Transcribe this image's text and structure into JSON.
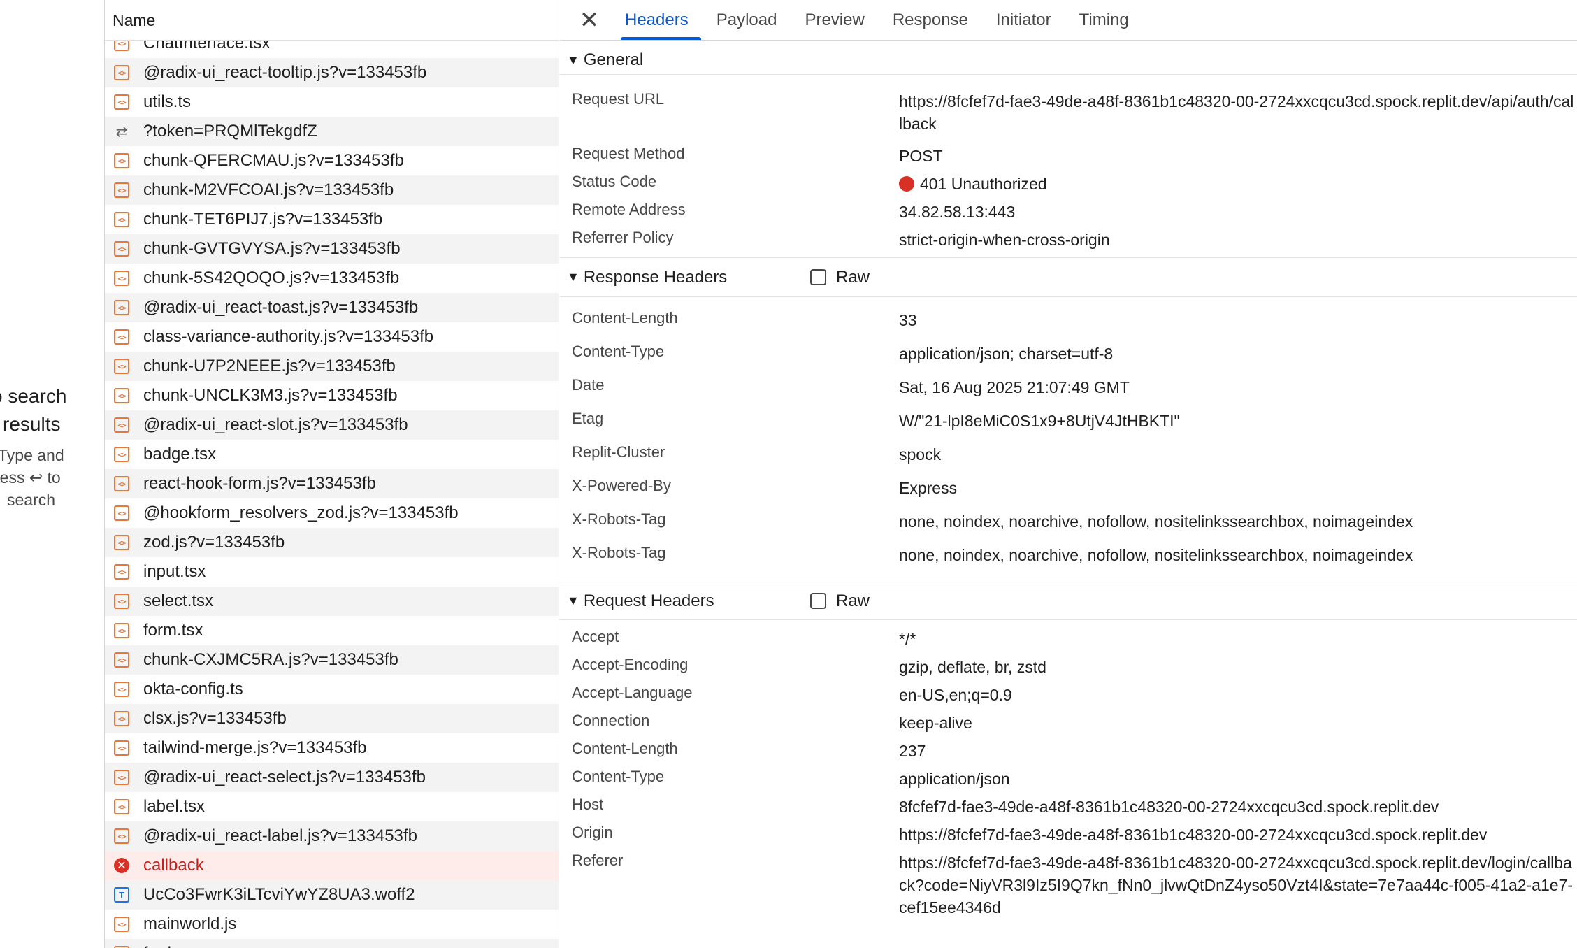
{
  "search_panel": {
    "no_results_line1": "o search",
    "no_results_line2": "results",
    "hint_line1": "Type and",
    "hint_line2": "ress ↩ to",
    "hint_line3": "search"
  },
  "request_list": {
    "header": "Name",
    "rows": [
      {
        "name": "ChatInterface.tsx",
        "icon": "script"
      },
      {
        "name": "@radix-ui_react-tooltip.js?v=133453fb",
        "icon": "script"
      },
      {
        "name": "utils.ts",
        "icon": "script"
      },
      {
        "name": "?token=PRQMlTekgdfZ",
        "icon": "redirect"
      },
      {
        "name": "chunk-QFERCMAU.js?v=133453fb",
        "icon": "script"
      },
      {
        "name": "chunk-M2VFCOAI.js?v=133453fb",
        "icon": "script"
      },
      {
        "name": "chunk-TET6PIJ7.js?v=133453fb",
        "icon": "script"
      },
      {
        "name": "chunk-GVTGVYSA.js?v=133453fb",
        "icon": "script"
      },
      {
        "name": "chunk-5S42QOQO.js?v=133453fb",
        "icon": "script"
      },
      {
        "name": "@radix-ui_react-toast.js?v=133453fb",
        "icon": "script"
      },
      {
        "name": "class-variance-authority.js?v=133453fb",
        "icon": "script"
      },
      {
        "name": "chunk-U7P2NEEE.js?v=133453fb",
        "icon": "script"
      },
      {
        "name": "chunk-UNCLK3M3.js?v=133453fb",
        "icon": "script"
      },
      {
        "name": "@radix-ui_react-slot.js?v=133453fb",
        "icon": "script"
      },
      {
        "name": "badge.tsx",
        "icon": "script"
      },
      {
        "name": "react-hook-form.js?v=133453fb",
        "icon": "script"
      },
      {
        "name": "@hookform_resolvers_zod.js?v=133453fb",
        "icon": "script"
      },
      {
        "name": "zod.js?v=133453fb",
        "icon": "script"
      },
      {
        "name": "input.tsx",
        "icon": "script"
      },
      {
        "name": "select.tsx",
        "icon": "script"
      },
      {
        "name": "form.tsx",
        "icon": "script"
      },
      {
        "name": "chunk-CXJMC5RA.js?v=133453fb",
        "icon": "script"
      },
      {
        "name": "okta-config.ts",
        "icon": "script"
      },
      {
        "name": "clsx.js?v=133453fb",
        "icon": "script"
      },
      {
        "name": "tailwind-merge.js?v=133453fb",
        "icon": "script"
      },
      {
        "name": "@radix-ui_react-select.js?v=133453fb",
        "icon": "script"
      },
      {
        "name": "label.tsx",
        "icon": "script"
      },
      {
        "name": "@radix-ui_react-label.js?v=133453fb",
        "icon": "script"
      },
      {
        "name": "callback",
        "icon": "error"
      },
      {
        "name": "UcCo3FwrK3iLTcviYwYZ8UA3.woff2",
        "icon": "font"
      },
      {
        "name": "mainworld.js",
        "icon": "script"
      },
      {
        "name": "f...d",
        "icon": "script"
      }
    ]
  },
  "icons": {
    "close": "close-icon",
    "script": "script-file-icon",
    "font": "font-file-icon",
    "redirect": "redirect-icon",
    "error": "error-icon",
    "triangle": "triangle-down-icon"
  },
  "colors": {
    "accent": "#0b57d0",
    "error": "#d93025",
    "script_icon": "#e8753a",
    "font_icon": "#1a73e8"
  },
  "detail": {
    "tabs": [
      "Headers",
      "Payload",
      "Preview",
      "Response",
      "Initiator",
      "Timing"
    ],
    "active_tab": "Headers",
    "general": {
      "title": "General",
      "rows": [
        {
          "k": "Request URL",
          "v": "https://8fcfef7d-fae3-49de-a48f-8361b1c48320-00-2724xxcqcu3cd.spock.replit.dev/api/auth/callback"
        },
        {
          "k": "Request Method",
          "v": "POST"
        },
        {
          "k": "Status Code",
          "v": "401 Unauthorized"
        },
        {
          "k": "Remote Address",
          "v": "34.82.58.13:443"
        },
        {
          "k": "Referrer Policy",
          "v": "strict-origin-when-cross-origin"
        }
      ]
    },
    "response_headers": {
      "title": "Response Headers",
      "raw_label": "Raw",
      "rows": [
        {
          "k": "Content-Length",
          "v": "33"
        },
        {
          "k": "Content-Type",
          "v": "application/json; charset=utf-8"
        },
        {
          "k": "Date",
          "v": "Sat, 16 Aug 2025 21:07:49 GMT"
        },
        {
          "k": "Etag",
          "v": "W/\"21-lpI8eMiC0S1x9+8UtjV4JtHBKTI\""
        },
        {
          "k": "Replit-Cluster",
          "v": "spock"
        },
        {
          "k": "X-Powered-By",
          "v": "Express"
        },
        {
          "k": "X-Robots-Tag",
          "v": "none, noindex, noarchive, nofollow, nositelinkssearchbox, noimageindex"
        },
        {
          "k": "X-Robots-Tag",
          "v": "none, noindex, noarchive, nofollow, nositelinkssearchbox, noimageindex"
        }
      ]
    },
    "request_headers": {
      "title": "Request Headers",
      "raw_label": "Raw",
      "rows": [
        {
          "k": "Accept",
          "v": "*/*"
        },
        {
          "k": "Accept-Encoding",
          "v": "gzip, deflate, br, zstd"
        },
        {
          "k": "Accept-Language",
          "v": "en-US,en;q=0.9"
        },
        {
          "k": "Connection",
          "v": "keep-alive"
        },
        {
          "k": "Content-Length",
          "v": "237"
        },
        {
          "k": "Content-Type",
          "v": "application/json"
        },
        {
          "k": "Host",
          "v": "8fcfef7d-fae3-49de-a48f-8361b1c48320-00-2724xxcqcu3cd.spock.replit.dev"
        },
        {
          "k": "Origin",
          "v": "https://8fcfef7d-fae3-49de-a48f-8361b1c48320-00-2724xxcqcu3cd.spock.replit.dev"
        },
        {
          "k": "Referer",
          "v": "https://8fcfef7d-fae3-49de-a48f-8361b1c48320-00-2724xxcqcu3cd.spock.replit.dev/login/callback?code=NiyVR3l9Iz5I9Q7kn_fNn0_jlvwQtDnZ4yso50Vzt4I&state=7e7aa44c-f005-41a2-a1e7-cef15ee4346d"
        }
      ]
    }
  }
}
